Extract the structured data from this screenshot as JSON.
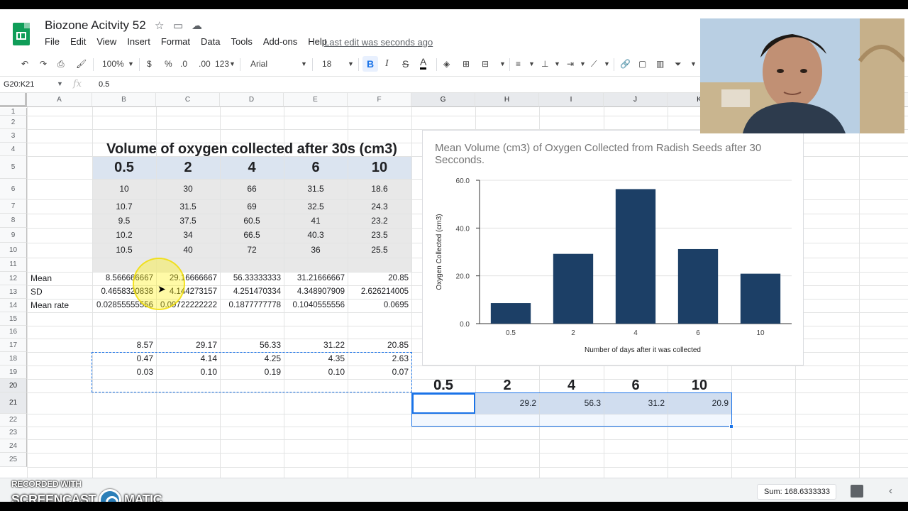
{
  "doc": {
    "title": "Biozone Acitvity 52",
    "last_edit": "Last edit was seconds ago"
  },
  "menu": [
    "File",
    "Edit",
    "View",
    "Insert",
    "Format",
    "Data",
    "Tools",
    "Add-ons",
    "Help"
  ],
  "toolbar": {
    "zoom": "100%",
    "currency": "$",
    "percent": "%",
    "dec_minus": ".0",
    "dec_plus": ".00",
    "more_formats": "123",
    "font": "Arial",
    "font_size": "18",
    "bold": "B",
    "italic": "I",
    "strike": "S",
    "text_color": "A"
  },
  "formula_bar": {
    "range": "G20:K21",
    "fx": "fx",
    "value": "0.5"
  },
  "columns": [
    "A",
    "B",
    "C",
    "D",
    "E",
    "F",
    "G",
    "H",
    "I",
    "J",
    "K"
  ],
  "rows": [
    "1",
    "2",
    "3",
    "4",
    "5",
    "6",
    "7",
    "8",
    "9",
    "10",
    "11",
    "12",
    "13",
    "14",
    "15",
    "16",
    "17",
    "18",
    "19",
    "20",
    "21",
    "22",
    "23",
    "24",
    "25"
  ],
  "table": {
    "title": "Volume of oxygen collected after 30s (cm3)",
    "headers": [
      "0.5",
      "2",
      "4",
      "6",
      "10"
    ],
    "data": [
      [
        "10",
        "30",
        "66",
        "31.5",
        "18.6"
      ],
      [
        "10.7",
        "31.5",
        "69",
        "32.5",
        "24.3"
      ],
      [
        "9.5",
        "37.5",
        "60.5",
        "41",
        "23.2"
      ],
      [
        "10.2",
        "34",
        "66.5",
        "40.3",
        "23.5"
      ],
      [
        "10.5",
        "40",
        "72",
        "36",
        "25.5"
      ]
    ],
    "stats": [
      {
        "label": "Mean",
        "values": [
          "8.566666667",
          "29.16666667",
          "56.33333333",
          "31.21666667",
          "20.85"
        ]
      },
      {
        "label": "SD",
        "values": [
          "0.4658320838",
          "4.144273157",
          "4.251470334",
          "4.348907909",
          "2.626214005"
        ]
      },
      {
        "label": "Mean rate",
        "values": [
          "0.02855555556",
          "0.09722222222",
          "0.1877777778",
          "0.1040555556",
          "0.0695"
        ]
      }
    ],
    "rounded": [
      [
        "8.57",
        "29.17",
        "56.33",
        "31.22",
        "20.85"
      ],
      [
        "0.47",
        "4.14",
        "4.25",
        "4.35",
        "2.63"
      ],
      [
        "0.03",
        "0.10",
        "0.19",
        "0.10",
        "0.07"
      ]
    ]
  },
  "summary": {
    "headers": [
      "0.5",
      "2",
      "4",
      "6",
      "10"
    ],
    "values": [
      "8.6",
      "29.2",
      "56.3",
      "31.2",
      "20.9"
    ]
  },
  "chart_data": {
    "type": "bar",
    "title": "Mean Volume (cm3) of Oxygen Collected from Radish Seeds after 30 Secconds.",
    "xlabel": "Number of days after it was collected",
    "ylabel": "Oxygen Collected (cm3)",
    "categories": [
      "0.5",
      "2",
      "4",
      "6",
      "10"
    ],
    "values": [
      8.6,
      29.2,
      56.3,
      31.2,
      20.9
    ],
    "ylim": [
      0,
      60
    ],
    "yticks": [
      "0.0",
      "20.0",
      "40.0",
      "60.0"
    ],
    "bar_color": "#1c3f66",
    "grid": true
  },
  "status": {
    "sum": "Sum: 168.6333333"
  },
  "watermark": {
    "line1": "RECORDED WITH",
    "line2": "SCREENCAST",
    "line3": "MATIC"
  },
  "colors": {
    "accent": "#1a73e8",
    "header_band": "#dbe4f0",
    "sheets_green": "#0f9d58"
  }
}
